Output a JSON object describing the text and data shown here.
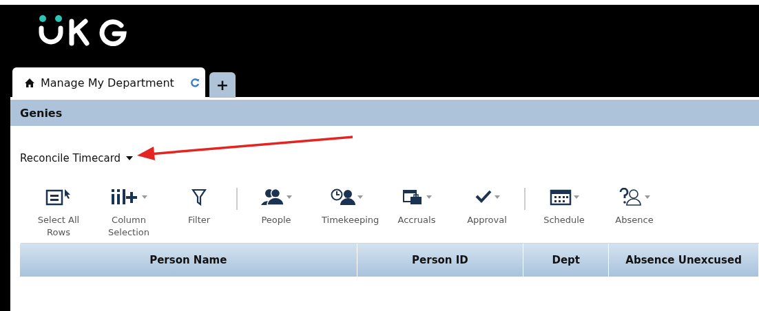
{
  "tabs": [
    {
      "label": "Manage My Department",
      "selected": true,
      "kind": "page"
    },
    {
      "label": "+",
      "selected": false,
      "kind": "add"
    }
  ],
  "panel": {
    "title": "Genies",
    "genie_selector": "Reconcile Timecard"
  },
  "toolbar": {
    "groups": [
      [
        {
          "kind": "select",
          "label": "Select All Rows",
          "dropdown": false
        },
        {
          "kind": "columns",
          "label": "Column Selection",
          "dropdown": true
        },
        {
          "kind": "filter",
          "label": "Filter",
          "dropdown": false
        }
      ],
      [
        {
          "kind": "people",
          "label": "People",
          "dropdown": true
        },
        {
          "kind": "clock",
          "label": "Timekeeping",
          "dropdown": true
        },
        {
          "kind": "accruals",
          "label": "Accruals",
          "dropdown": true
        },
        {
          "kind": "check",
          "label": "Approval",
          "dropdown": true
        }
      ],
      [
        {
          "kind": "calendar",
          "label": "Schedule",
          "dropdown": true
        },
        {
          "kind": "absence",
          "label": "Absence",
          "dropdown": true
        }
      ]
    ]
  },
  "table": {
    "columns": [
      "Person Name",
      "Person ID",
      "Dept",
      "Absence Unexcused"
    ]
  }
}
